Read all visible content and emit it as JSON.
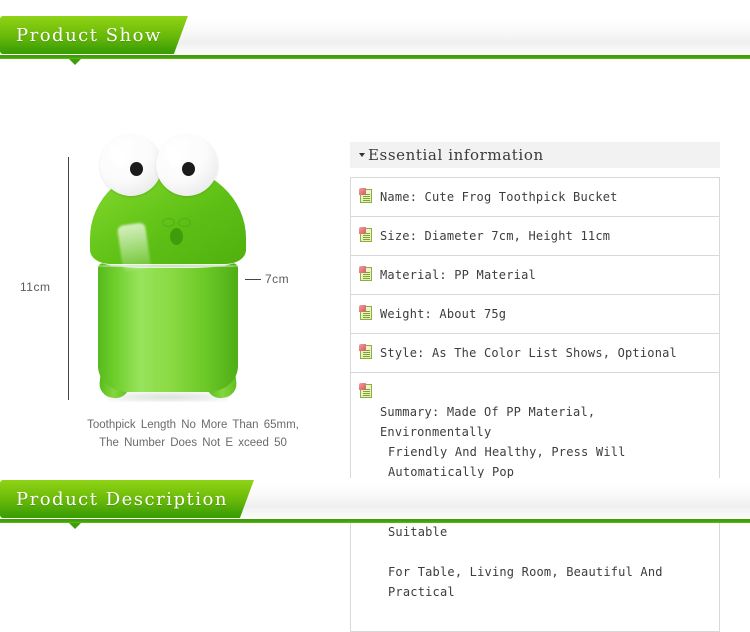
{
  "banners": {
    "top": {
      "title": "Product Show"
    },
    "bottom": {
      "title": "Product Description"
    }
  },
  "product": {
    "measurements": {
      "height_label": "11cm",
      "width_label": "7cm"
    },
    "caption_line1": "Toothpick Length No More Than 65mm,",
    "caption_line2": "The Number Does Not E  xceed 50",
    "image_alt": "cute-green-frog-toothpick-bucket"
  },
  "info_panel": {
    "header_title": "Essential information",
    "rows": [
      {
        "icon": "note-icon",
        "text": "Name: Cute Frog Toothpick Bucket"
      },
      {
        "icon": "note-icon",
        "text": "Size: Diameter 7cm, Height 11cm"
      },
      {
        "icon": "note-icon",
        "text": "Material: PP Material"
      },
      {
        "icon": "note-icon",
        "text": "Weight: About 75g"
      },
      {
        "icon": "note-icon",
        "text": "Style: As The Color List Shows, Optional"
      }
    ],
    "summary": {
      "icon": "note-icon",
      "line1": "Summary: Made Of PP Material, Environmentally",
      "line2": "Friendly And Healthy, Press Will Automatically Pop",
      "line3": "Up Toothpick, Novel And Interesting, Suitable",
      "line4": "For Table, Living Room, Beautiful And Practical"
    }
  },
  "colors": {
    "brand_green_light": "#8fd318",
    "brand_green_dark": "#3a9c05",
    "underline_green": "#3f9f08",
    "panel_header_bg": "#f2f2f2",
    "panel_border": "#d8d8d8",
    "product_green": "#73ce22"
  }
}
